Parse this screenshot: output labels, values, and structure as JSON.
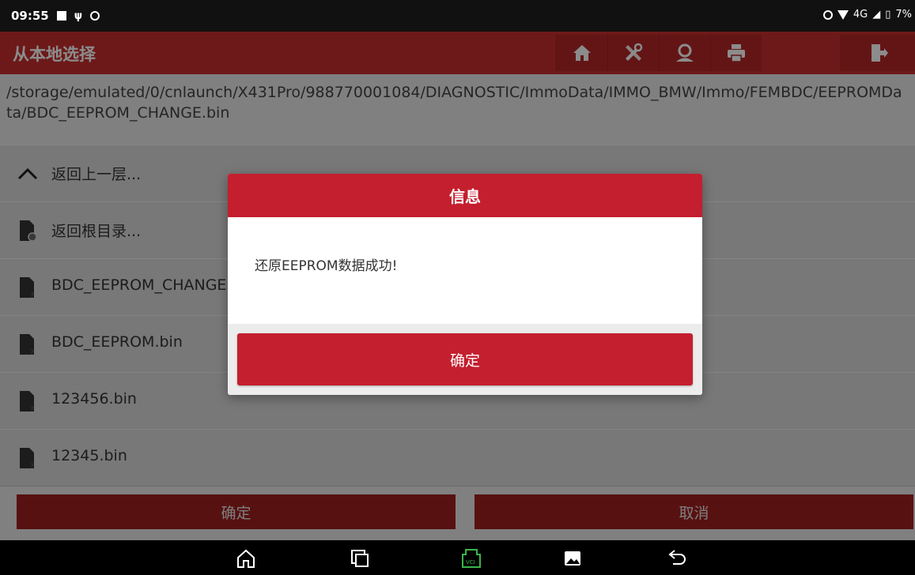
{
  "status_bar": {
    "time": "09:55",
    "network": "4G",
    "battery": "7%"
  },
  "header": {
    "title": "从本地选择",
    "toolbar_icons": [
      "home-icon",
      "tools-icon",
      "user-icon",
      "print-icon",
      "exit-icon"
    ]
  },
  "path": "/storage/emulated/0/cnlaunch/X431Pro/988770001084/DIAGNOSTIC/ImmoData/IMMO_BMW/Immo/FEMBDC/EEPROMData/BDC_EEPROM_CHANGE.bin",
  "list": {
    "items": [
      {
        "label": "返回上一层...",
        "icon": "chevron-up-icon"
      },
      {
        "label": "返回根目录...",
        "icon": "folder-settings-icon"
      },
      {
        "label": "BDC_EEPROM_CHANGE.bin",
        "icon": "file-unknown-icon"
      },
      {
        "label": "BDC_EEPROM.bin",
        "icon": "file-unknown-icon"
      },
      {
        "label": "123456.bin",
        "icon": "file-unknown-icon"
      },
      {
        "label": "12345.bin",
        "icon": "file-unknown-icon"
      }
    ]
  },
  "footer": {
    "confirm_label": "确定",
    "cancel_label": "取消"
  },
  "dialog": {
    "title": "信息",
    "message": "还原EEPROM数据成功!",
    "ok_label": "确定"
  },
  "colors": {
    "brand_red": "#c62e2e",
    "dialog_red": "#c41f2e"
  }
}
